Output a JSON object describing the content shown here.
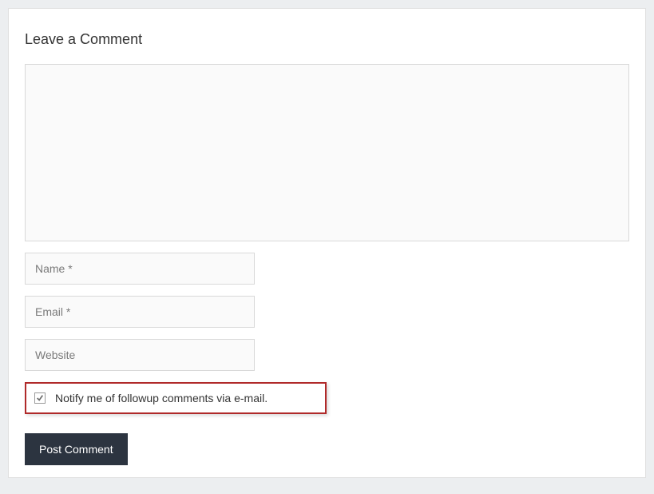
{
  "form": {
    "heading": "Leave a Comment",
    "comment_value": "",
    "name_placeholder": "Name *",
    "name_value": "",
    "email_placeholder": "Email *",
    "email_value": "",
    "website_placeholder": "Website",
    "website_value": "",
    "notify_label": "Notify me of followup comments via e-mail.",
    "notify_checked": true,
    "submit_label": "Post Comment"
  }
}
